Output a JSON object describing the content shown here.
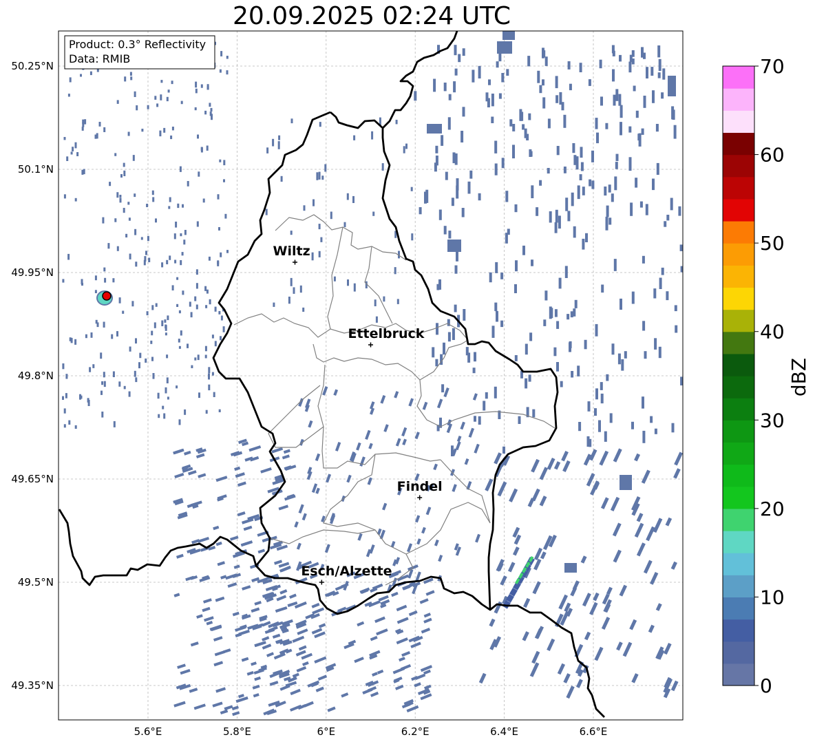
{
  "title": "20.09.2025 02:24 UTC",
  "info_box": {
    "line1": "Product: 0.3° Reflectivity",
    "line2": "Data: RMIB"
  },
  "map": {
    "lon_ticks": [
      "5.6°E",
      "5.8°E",
      "6°E",
      "6.2°E",
      "6.4°E",
      "6.6°E"
    ],
    "lat_ticks": [
      "50.25°N",
      "50.1°N",
      "49.95°N",
      "49.8°N",
      "49.65°N",
      "49.5°N",
      "49.35°N"
    ],
    "cities": [
      {
        "name": "Wiltz",
        "lon": 5.93,
        "lat": 49.965
      },
      {
        "name": "Ettelbruck",
        "lon": 6.1,
        "lat": 49.845
      },
      {
        "name": "Findel",
        "lon": 6.21,
        "lat": 49.623
      },
      {
        "name": "Esch/Alzette",
        "lon": 5.99,
        "lat": 49.5
      }
    ],
    "radar_site": {
      "lon": 5.505,
      "lat": 49.915
    },
    "border_color": "#000000",
    "canton_color": "#808080",
    "echo_color": "#5f77a8"
  },
  "colorbar": {
    "label": "dBZ",
    "min": 0,
    "max": 70,
    "step": 2.5,
    "tick_labels": [
      "0",
      "10",
      "20",
      "30",
      "40",
      "50",
      "60",
      "70"
    ],
    "colors": [
      "#6676a6",
      "#5468a1",
      "#445ea3",
      "#4b7cb3",
      "#5c9fc7",
      "#62c0d9",
      "#5fd7c3",
      "#3fd36f",
      "#13c61e",
      "#0fba1a",
      "#10a816",
      "#0e9713",
      "#0c7f10",
      "#0c6a0d",
      "#0b5a0d",
      "#437810",
      "#a9b207",
      "#fdd604",
      "#fbb404",
      "#fc9c04",
      "#fc7b04",
      "#e20404",
      "#bc0404",
      "#9c0404",
      "#7a0101",
      "#fde0fb",
      "#fcb4fb",
      "#fc70f8",
      "#e833ea"
    ]
  }
}
